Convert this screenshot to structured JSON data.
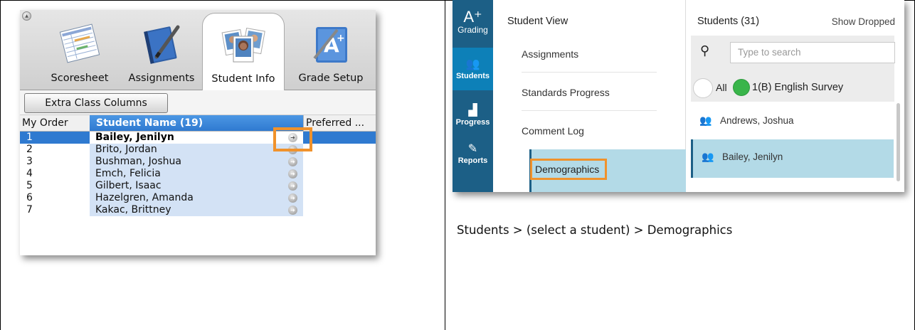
{
  "left": {
    "tabs": [
      {
        "label": "Scoresheet",
        "icon": "scoresheet-icon"
      },
      {
        "label": "Assignments",
        "icon": "assignments-icon"
      },
      {
        "label": "Student Info",
        "icon": "student-info-icon"
      },
      {
        "label": "Grade Setup",
        "icon": "grade-setup-icon"
      }
    ],
    "extra_button": "Extra Class Columns",
    "columns": {
      "order": "My Order",
      "name": "Student Name (19)",
      "preferred": "Preferred ..."
    },
    "rows": [
      {
        "order": "1",
        "name": "Bailey, Jenilyn"
      },
      {
        "order": "2",
        "name": "Brito, Jordan"
      },
      {
        "order": "3",
        "name": "Bushman, Joshua"
      },
      {
        "order": "4",
        "name": "Emch, Felicia"
      },
      {
        "order": "5",
        "name": "Gilbert, Isaac"
      },
      {
        "order": "6",
        "name": "Hazelgren, Amanda"
      },
      {
        "order": "7",
        "name": "Kakac, Brittney"
      }
    ],
    "highlight_color": "#f0922c"
  },
  "right": {
    "nav": [
      {
        "glyph": "A⁺",
        "label": "Grading"
      },
      {
        "glyph": "👥",
        "label": "Students"
      },
      {
        "glyph": "▟",
        "label": "Progress"
      },
      {
        "glyph": "✎",
        "label": "Reports"
      }
    ],
    "view_title": "Student View",
    "view_items": [
      "Assignments",
      "Standards Progress",
      "Comment Log",
      "Demographics"
    ],
    "students_title": "Students (31)",
    "show_dropped": "Show Dropped",
    "search_placeholder": "Type to search",
    "filter_all": "All",
    "filter_class": "1(B) English Survey",
    "students": [
      "Andrews, Joshua",
      "Bailey, Jenilyn"
    ],
    "nav_color": "#1c5f86",
    "selection_color": "#b3dae7"
  },
  "caption": "Students > (select a student) > Demographics"
}
